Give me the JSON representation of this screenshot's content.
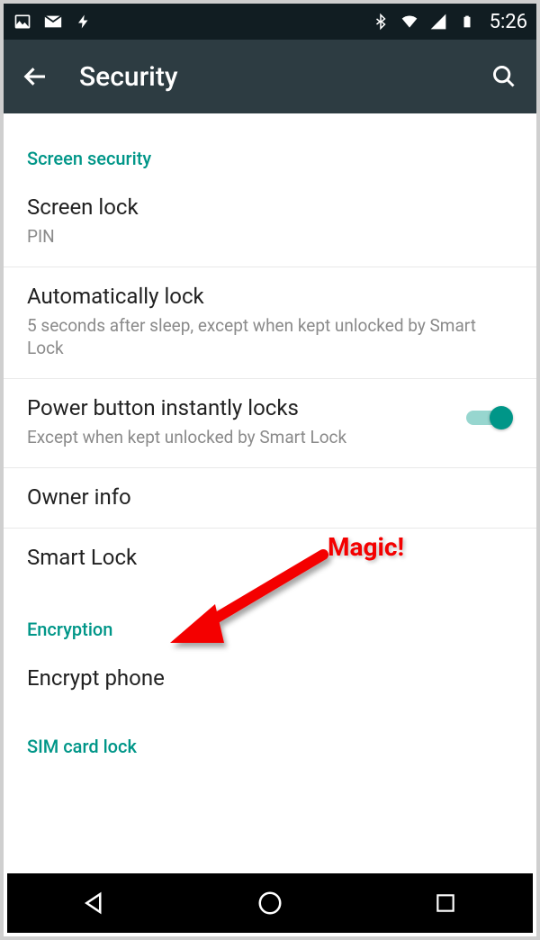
{
  "status": {
    "time": "5:26"
  },
  "appbar": {
    "title": "Security"
  },
  "sections": {
    "s0": {
      "header": "Screen security"
    },
    "s1": {
      "header": "Encryption"
    },
    "s2": {
      "header": "SIM card lock"
    }
  },
  "items": {
    "screen_lock": {
      "label": "Screen lock",
      "sub": "PIN"
    },
    "auto_lock": {
      "label": "Automatically lock",
      "sub": "5 seconds after sleep, except when kept unlocked by Smart Lock"
    },
    "power_lock": {
      "label": "Power button instantly locks",
      "sub": "Except when kept unlocked by Smart Lock",
      "on": true
    },
    "owner_info": {
      "label": "Owner info"
    },
    "smart_lock": {
      "label": "Smart Lock"
    },
    "encrypt_phone": {
      "label": "Encrypt phone"
    }
  },
  "annotation": {
    "text": "Magic!"
  }
}
